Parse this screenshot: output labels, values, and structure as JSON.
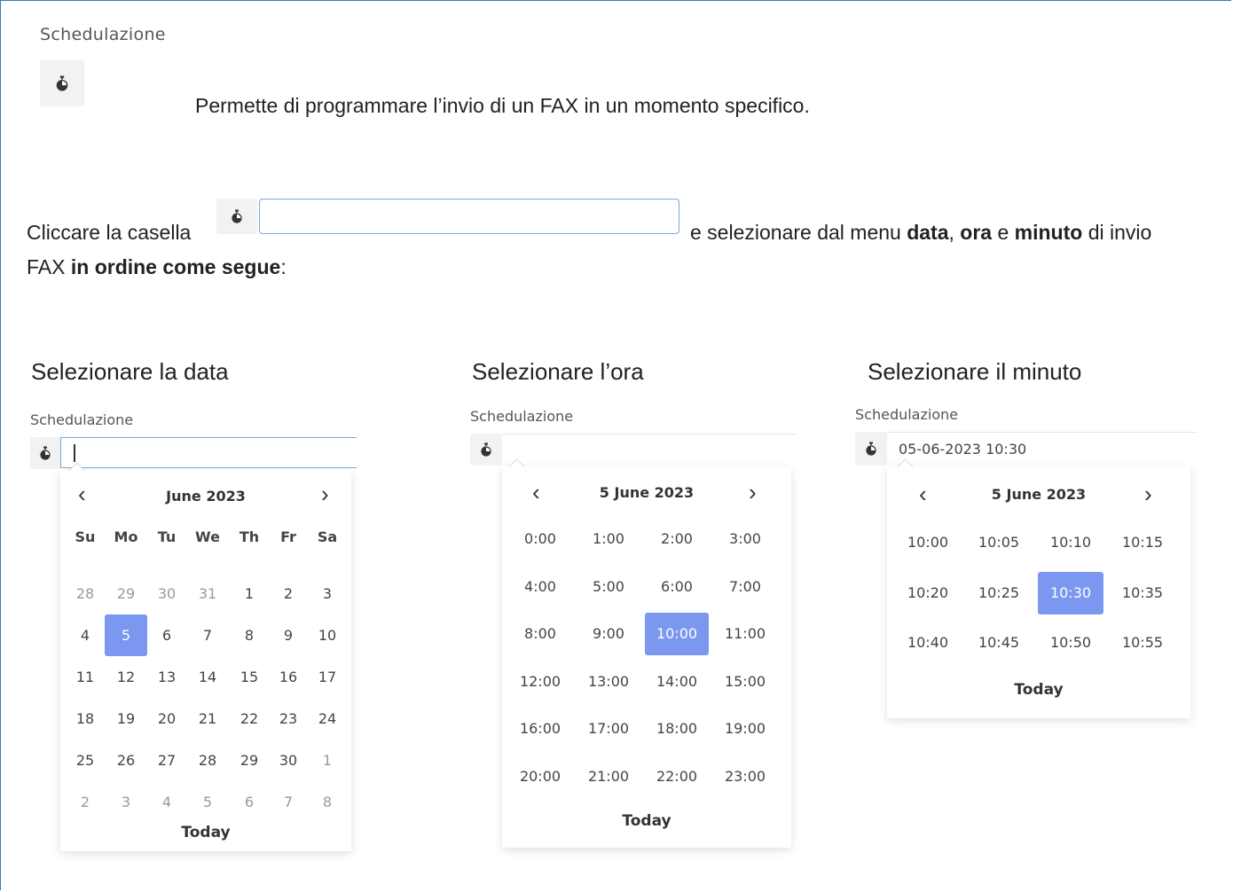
{
  "section_title": "Schedulazione",
  "description": "Permette di programmare l’invio di un FAX in un momento specifico.",
  "instruction": {
    "prefix": "Cliccare la casella",
    "middle": "e selezionare dal menu",
    "w_data": "data",
    "comma": ",",
    "w_ora": "ora",
    "e": "e",
    "w_minuto": "minuto",
    "suffix": "di invio",
    "line2_prefix": "FAX",
    "line2_bold": "in ordine come segue",
    "line2_suffix": ":"
  },
  "panels": {
    "date": {
      "label": "Selezionare la data",
      "field_label": "Schedulazione",
      "header": "June 2023",
      "dow": [
        "Su",
        "Mo",
        "Tu",
        "We",
        "Th",
        "Fr",
        "Sa"
      ],
      "weeks": [
        [
          "28",
          "29",
          "30",
          "31",
          "1",
          "2",
          "3"
        ],
        [
          "4",
          "5",
          "6",
          "7",
          "8",
          "9",
          "10"
        ],
        [
          "11",
          "12",
          "13",
          "14",
          "15",
          "16",
          "17"
        ],
        [
          "18",
          "19",
          "20",
          "21",
          "22",
          "23",
          "24"
        ],
        [
          "25",
          "26",
          "27",
          "28",
          "29",
          "30",
          "1"
        ],
        [
          "2",
          "3",
          "4",
          "5",
          "6",
          "7",
          "8"
        ]
      ],
      "selected": "5",
      "today": "Today"
    },
    "hour": {
      "label": "Selezionare l’ora",
      "field_label": "Schedulazione",
      "header": "5 June 2023",
      "hours": [
        "0:00",
        "1:00",
        "2:00",
        "3:00",
        "4:00",
        "5:00",
        "6:00",
        "7:00",
        "8:00",
        "9:00",
        "10:00",
        "11:00",
        "12:00",
        "13:00",
        "14:00",
        "15:00",
        "16:00",
        "17:00",
        "18:00",
        "19:00",
        "20:00",
        "21:00",
        "22:00",
        "23:00"
      ],
      "selected": "10:00",
      "today": "Today"
    },
    "minute": {
      "label": "Selezionare il minuto",
      "field_label": "Schedulazione",
      "input_value": "05-06-2023 10:30",
      "header": "5 June 2023",
      "minutes": [
        "10:00",
        "10:05",
        "10:10",
        "10:15",
        "10:20",
        "10:25",
        "10:30",
        "10:35",
        "10:40",
        "10:45",
        "10:50",
        "10:55"
      ],
      "selected": "10:30",
      "today": "Today"
    }
  },
  "nav": {
    "prev": "‹",
    "next": "›"
  },
  "icons": {
    "stopwatch": "stopwatch-icon"
  },
  "colors": {
    "accent": "#7b97f0",
    "frame": "#2f7fc1",
    "input_border": "#7aa6e0"
  }
}
